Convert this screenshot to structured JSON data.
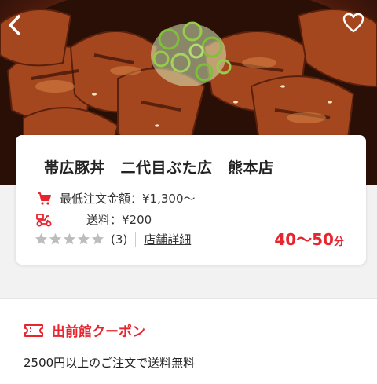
{
  "header": {
    "back_icon": "chevron-left-icon",
    "favorite_icon": "heart-outline-icon"
  },
  "store": {
    "name": "帯広豚丼　二代目ぶた広　熊本店",
    "min_order_label": "最低注文金額",
    "min_order_value": "：¥1,300〜",
    "delivery_fee_label": "送料",
    "delivery_fee_value": "：¥200",
    "rating_count": "(3)",
    "rating_stars": 0,
    "details_link": "店舗詳細",
    "delivery_time": "40〜50",
    "delivery_time_unit": "分"
  },
  "coupon": {
    "title": "出前館クーポン",
    "description": "2500円以上のご注文で送料無料"
  },
  "colors": {
    "accent": "#e8242f",
    "star_inactive": "#bdbdbd"
  }
}
